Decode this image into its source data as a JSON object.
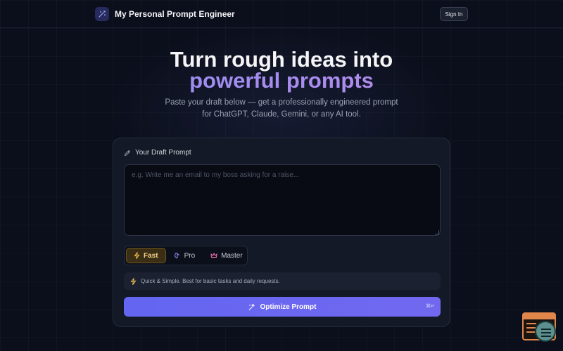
{
  "header": {
    "app_title": "My Personal Prompt Engineer",
    "sign_in_label": "Sign In"
  },
  "hero": {
    "title_line1": "Turn rough ideas into",
    "title_line2": "powerful prompts",
    "subtitle_line1": "Paste your draft below — get a professionally engineered prompt",
    "subtitle_line2": "for ChatGPT, Claude, Gemini, or any AI tool."
  },
  "editor": {
    "label": "Your Draft Prompt",
    "value": "",
    "placeholder": "e.g. Write me an email to my boss asking for a raise..."
  },
  "modes": {
    "selected": "Fast",
    "items": [
      {
        "label": "Fast",
        "icon": "lightning-icon"
      },
      {
        "label": "Pro",
        "icon": "brain-icon"
      },
      {
        "label": "Master",
        "icon": "crown-icon"
      }
    ],
    "description": "Quick & Simple. Best for basic tasks and daily requests."
  },
  "action": {
    "optimize_label": "Optimize Prompt",
    "shortcut": "⌘↵"
  },
  "colors": {
    "background": "#0b0f1c",
    "accent": "#6366f1",
    "fast_accent": "#f6d28a",
    "gradient_start": "#8b8ff5",
    "gradient_end": "#c18ae8"
  }
}
